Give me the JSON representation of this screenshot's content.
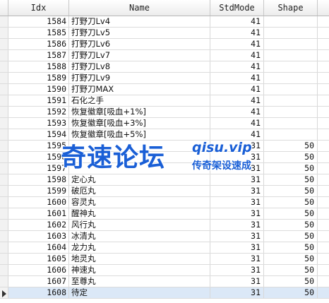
{
  "columns": {
    "idx": "Idx",
    "name": "Name",
    "stdmode": "StdMode",
    "shape": "Shape"
  },
  "rows": [
    {
      "idx": "1584",
      "name": "打野刀Lv4",
      "stdmode": "41",
      "shape": ""
    },
    {
      "idx": "1585",
      "name": "打野刀Lv5",
      "stdmode": "41",
      "shape": ""
    },
    {
      "idx": "1586",
      "name": "打野刀Lv6",
      "stdmode": "41",
      "shape": ""
    },
    {
      "idx": "1587",
      "name": "打野刀Lv7",
      "stdmode": "41",
      "shape": ""
    },
    {
      "idx": "1588",
      "name": "打野刀Lv8",
      "stdmode": "41",
      "shape": ""
    },
    {
      "idx": "1589",
      "name": "打野刀Lv9",
      "stdmode": "41",
      "shape": ""
    },
    {
      "idx": "1590",
      "name": "打野刀MAX",
      "stdmode": "41",
      "shape": ""
    },
    {
      "idx": "1591",
      "name": "石化之手",
      "stdmode": "41",
      "shape": ""
    },
    {
      "idx": "1592",
      "name": "恢复徽章[吸血+1%]",
      "stdmode": "41",
      "shape": ""
    },
    {
      "idx": "1593",
      "name": "恢复徽章[吸血+3%]",
      "stdmode": "41",
      "shape": ""
    },
    {
      "idx": "1594",
      "name": "恢复徽章[吸血+5%]",
      "stdmode": "41",
      "shape": ""
    },
    {
      "idx": "1595",
      "name": "",
      "stdmode": "31",
      "shape": "50"
    },
    {
      "idx": "1596",
      "name": "",
      "stdmode": "31",
      "shape": "50"
    },
    {
      "idx": "1597",
      "name": "",
      "stdmode": "31",
      "shape": "50"
    },
    {
      "idx": "1598",
      "name": "定心丸",
      "stdmode": "31",
      "shape": "50"
    },
    {
      "idx": "1599",
      "name": "破厄丸",
      "stdmode": "31",
      "shape": "50"
    },
    {
      "idx": "1600",
      "name": "容灵丸",
      "stdmode": "31",
      "shape": "50"
    },
    {
      "idx": "1601",
      "name": "醒神丸",
      "stdmode": "31",
      "shape": "50"
    },
    {
      "idx": "1602",
      "name": "风行丸",
      "stdmode": "31",
      "shape": "50"
    },
    {
      "idx": "1603",
      "name": "冰清丸",
      "stdmode": "31",
      "shape": "50"
    },
    {
      "idx": "1604",
      "name": "龙力丸",
      "stdmode": "31",
      "shape": "50"
    },
    {
      "idx": "1605",
      "name": "地灵丸",
      "stdmode": "31",
      "shape": "50"
    },
    {
      "idx": "1606",
      "name": "神速丸",
      "stdmode": "31",
      "shape": "50"
    },
    {
      "idx": "1607",
      "name": "至尊丸",
      "stdmode": "31",
      "shape": "50"
    },
    {
      "idx": "1608",
      "name": "待定",
      "stdmode": "31",
      "shape": "50"
    }
  ],
  "selected_row": "1608",
  "watermark": {
    "main": "奇速论坛",
    "domain": "qisu.vip",
    "sub": "传奇架设速成"
  }
}
